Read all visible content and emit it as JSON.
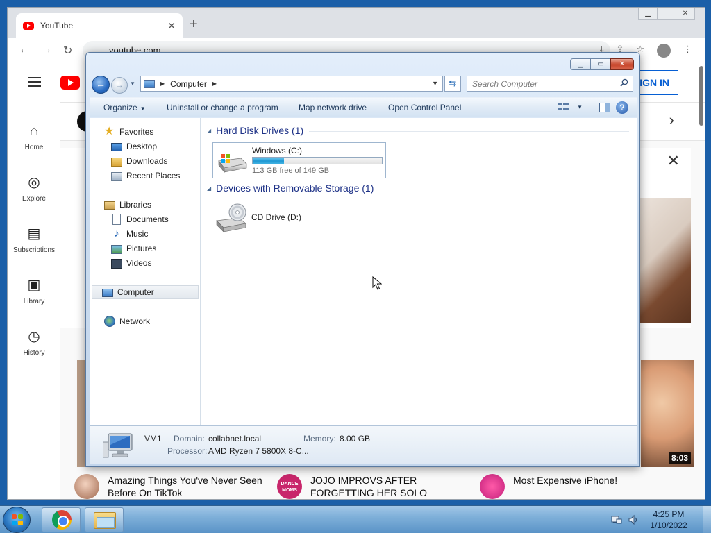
{
  "chrome": {
    "tab_title": "YouTube",
    "url": "youtube.com"
  },
  "youtube": {
    "sign_in_label": "SIGN IN",
    "guide": [
      {
        "label": "Home"
      },
      {
        "label": "Explore"
      },
      {
        "label": "Subscriptions"
      },
      {
        "label": "Library"
      },
      {
        "label": "History"
      }
    ],
    "videos": [
      {
        "title": "Amazing Things You've Never Seen Before On TikTok"
      },
      {
        "title": "JOJO IMPROVS AFTER FORGETTING HER SOLO"
      },
      {
        "title": "Most Expensive iPhone!"
      }
    ],
    "thumbnail_duration": "8:03",
    "channel_badge_text": "DANCE MOMS"
  },
  "explorer": {
    "address": {
      "location": "Computer"
    },
    "search": {
      "placeholder": "Search Computer"
    },
    "commands": {
      "organize": "Organize",
      "uninstall": "Uninstall or change a program",
      "map_drive": "Map network drive",
      "control_panel": "Open Control Panel"
    },
    "nav": {
      "favorites": "Favorites",
      "desktop": "Desktop",
      "downloads": "Downloads",
      "recent_places": "Recent Places",
      "libraries": "Libraries",
      "documents": "Documents",
      "music": "Music",
      "pictures": "Pictures",
      "videos": "Videos",
      "computer": "Computer",
      "network": "Network"
    },
    "groups": {
      "hdd": "Hard Disk Drives (1)",
      "removable": "Devices with Removable Storage (1)"
    },
    "drives": {
      "c_name": "Windows (C:)",
      "c_free": "113 GB free of 149 GB",
      "c_used_fraction": 0.24,
      "d_name": "CD Drive (D:)"
    },
    "details": {
      "name": "VM1",
      "domain_label": "Domain:",
      "domain_value": "collabnet.local",
      "memory_label": "Memory:",
      "memory_value": "8.00 GB",
      "processor_label": "Processor:",
      "processor_value": "AMD Ryzen 7 5800X 8-C..."
    }
  },
  "taskbar": {
    "time": "4:25 PM",
    "date": "1/10/2022"
  },
  "colors": {
    "youtube_red": "#ff0000",
    "group_header_blue": "#1e3287",
    "drive_fill": "#1e98d3"
  }
}
